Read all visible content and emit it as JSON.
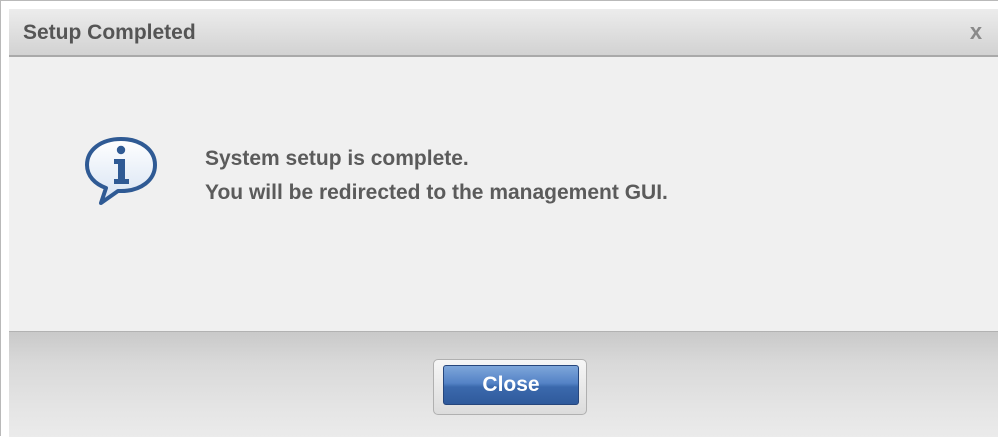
{
  "dialog": {
    "title": "Setup Completed",
    "close_glyph": "x",
    "message_line_1": "System setup is complete.",
    "message_line_2": "You will be redirected to the management GUI.",
    "close_button_label": "Close",
    "icon": "info-icon"
  },
  "colors": {
    "accent_button": "#3b69ad",
    "icon_blue": "#2f5a94"
  }
}
